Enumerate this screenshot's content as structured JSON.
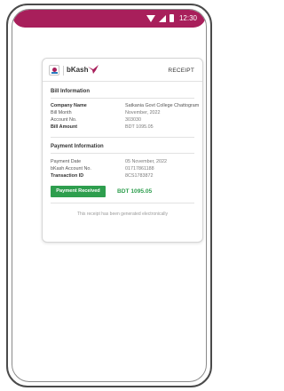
{
  "status_bar": {
    "time": "12:30",
    "color": "#a81f5b",
    "icons": [
      "wifi-icon",
      "signal-icon",
      "battery-icon"
    ]
  },
  "receipt": {
    "brand": "bKash",
    "header_label": "RECEIPT",
    "bill_section": {
      "title": "Bill Information",
      "rows": [
        {
          "label": "Company Name",
          "value": "Satkania Govt College Chattogram"
        },
        {
          "label": "Bill Month",
          "value": "November, 2022"
        },
        {
          "label": "Account No.",
          "value": "303030"
        },
        {
          "label": "Bill Amount",
          "value": "BDT 1095.05"
        }
      ]
    },
    "payment_section": {
      "title": "Payment Information",
      "rows": [
        {
          "label": "Payment Date",
          "value": "05 November, 2022"
        },
        {
          "label": "bKash Account No.",
          "value": "01717861188"
        },
        {
          "label": "Transaction ID",
          "value": "8CS1783872"
        }
      ]
    },
    "status_badge": "Payment Received",
    "paid_amount": "BDT 1095.05",
    "footer_note": "This receipt has been generated electronically",
    "accent_color": "#2e9e4e"
  }
}
